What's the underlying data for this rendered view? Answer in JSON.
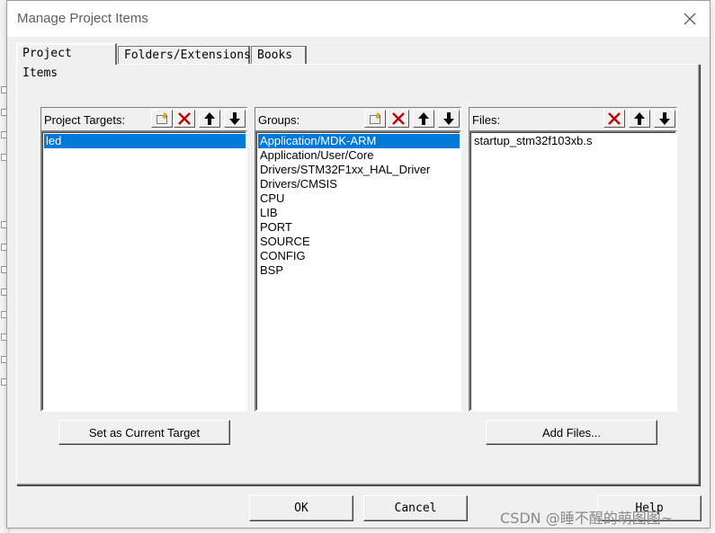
{
  "dialog": {
    "title": "Manage Project Items",
    "tabs": [
      "Project Items",
      "Folders/Extensions",
      "Books"
    ]
  },
  "targets": {
    "label": "Project Targets:",
    "items": [
      "led"
    ],
    "selected_index": 0,
    "action_button": "Set as Current Target"
  },
  "groups": {
    "label": "Groups:",
    "items": [
      "Application/MDK-ARM",
      "Application/User/Core",
      "Drivers/STM32F1xx_HAL_Driver",
      "Drivers/CMSIS",
      "CPU",
      "LIB",
      "PORT",
      "SOURCE",
      "CONFIG",
      "BSP"
    ],
    "selected_index": 0
  },
  "files": {
    "label": "Files:",
    "items": [
      "startup_stm32f103xb.s"
    ],
    "action_button": "Add Files..."
  },
  "footer": {
    "ok": "OK",
    "cancel": "Cancel",
    "help": "Help"
  },
  "watermark": "CSDN @睡不醒的萌图图~",
  "colors": {
    "selection": "#0078d7",
    "delete": "#c00000",
    "dialog_bg": "#f0f0f0"
  },
  "icons": [
    "new-icon",
    "delete-icon",
    "move-up-icon",
    "move-down-icon",
    "close-icon"
  ]
}
